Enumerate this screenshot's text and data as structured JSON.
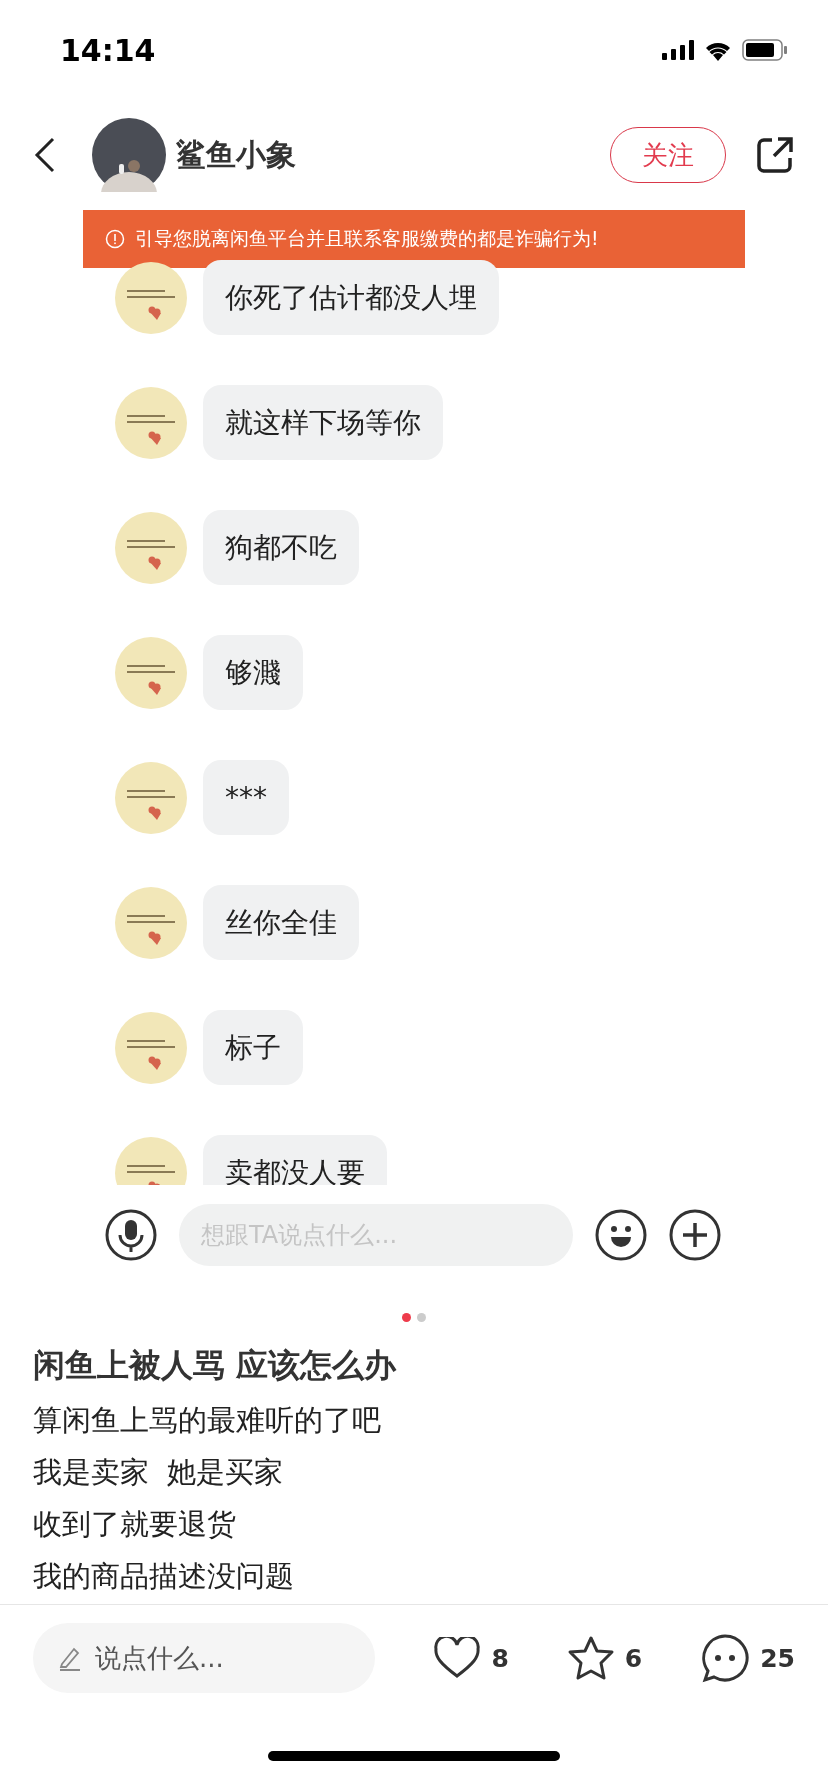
{
  "status_bar": {
    "time": "14:14"
  },
  "header": {
    "username": "鲨鱼小象",
    "follow_button": "关注"
  },
  "chat": {
    "warning": "引导您脱离闲鱼平台并且联系客服缴费的都是诈骗行为!",
    "messages": [
      {
        "text": "你死了估计都没人埋"
      },
      {
        "text": "就这样下场等你"
      },
      {
        "text": "狗都不吃"
      },
      {
        "text": "够濺"
      },
      {
        "text": "***"
      },
      {
        "text": "丝你全佳"
      },
      {
        "text": "标子"
      },
      {
        "text": "卖都没人要"
      }
    ],
    "input_placeholder": "想跟TA说点什么..."
  },
  "carousel": {
    "dots": [
      {
        "selected": true
      },
      {
        "selected": false
      }
    ]
  },
  "post": {
    "title": "闲鱼上被人骂 应该怎么办",
    "lines": [
      "算闲鱼上骂的最难听的了吧",
      "我是卖家  她是买家",
      "收到了就要退货",
      "我的商品描述没问题"
    ]
  },
  "bottom_bar": {
    "comment_placeholder": "说点什么...",
    "likes": "8",
    "favorites": "6",
    "comments": "25"
  }
}
